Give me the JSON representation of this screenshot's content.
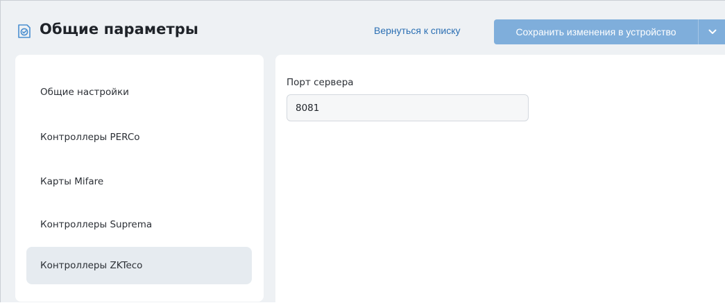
{
  "header": {
    "title": "Общие параметры",
    "back_link": "Вернуться к списку",
    "save_button": "Сохранить изменения в устройство",
    "icon": "settings-check-icon",
    "dropdown_icon": "chevron-down-icon"
  },
  "sidebar": {
    "items": [
      {
        "label": "Общие настройки",
        "active": false
      },
      {
        "label": "Контроллеры PERCo",
        "active": false
      },
      {
        "label": "Карты Mifare",
        "active": false
      },
      {
        "label": "Контроллеры Suprema",
        "active": false
      },
      {
        "label": "Контроллеры ZKTeco",
        "active": true
      }
    ]
  },
  "form": {
    "server_port_label": "Порт сервера",
    "server_port_value": "8081"
  },
  "colors": {
    "accent": "#2b6fb3",
    "save_button_bg": "#7faedb",
    "page_bg": "#eef1f4",
    "active_item_bg": "#e6ebf0"
  }
}
